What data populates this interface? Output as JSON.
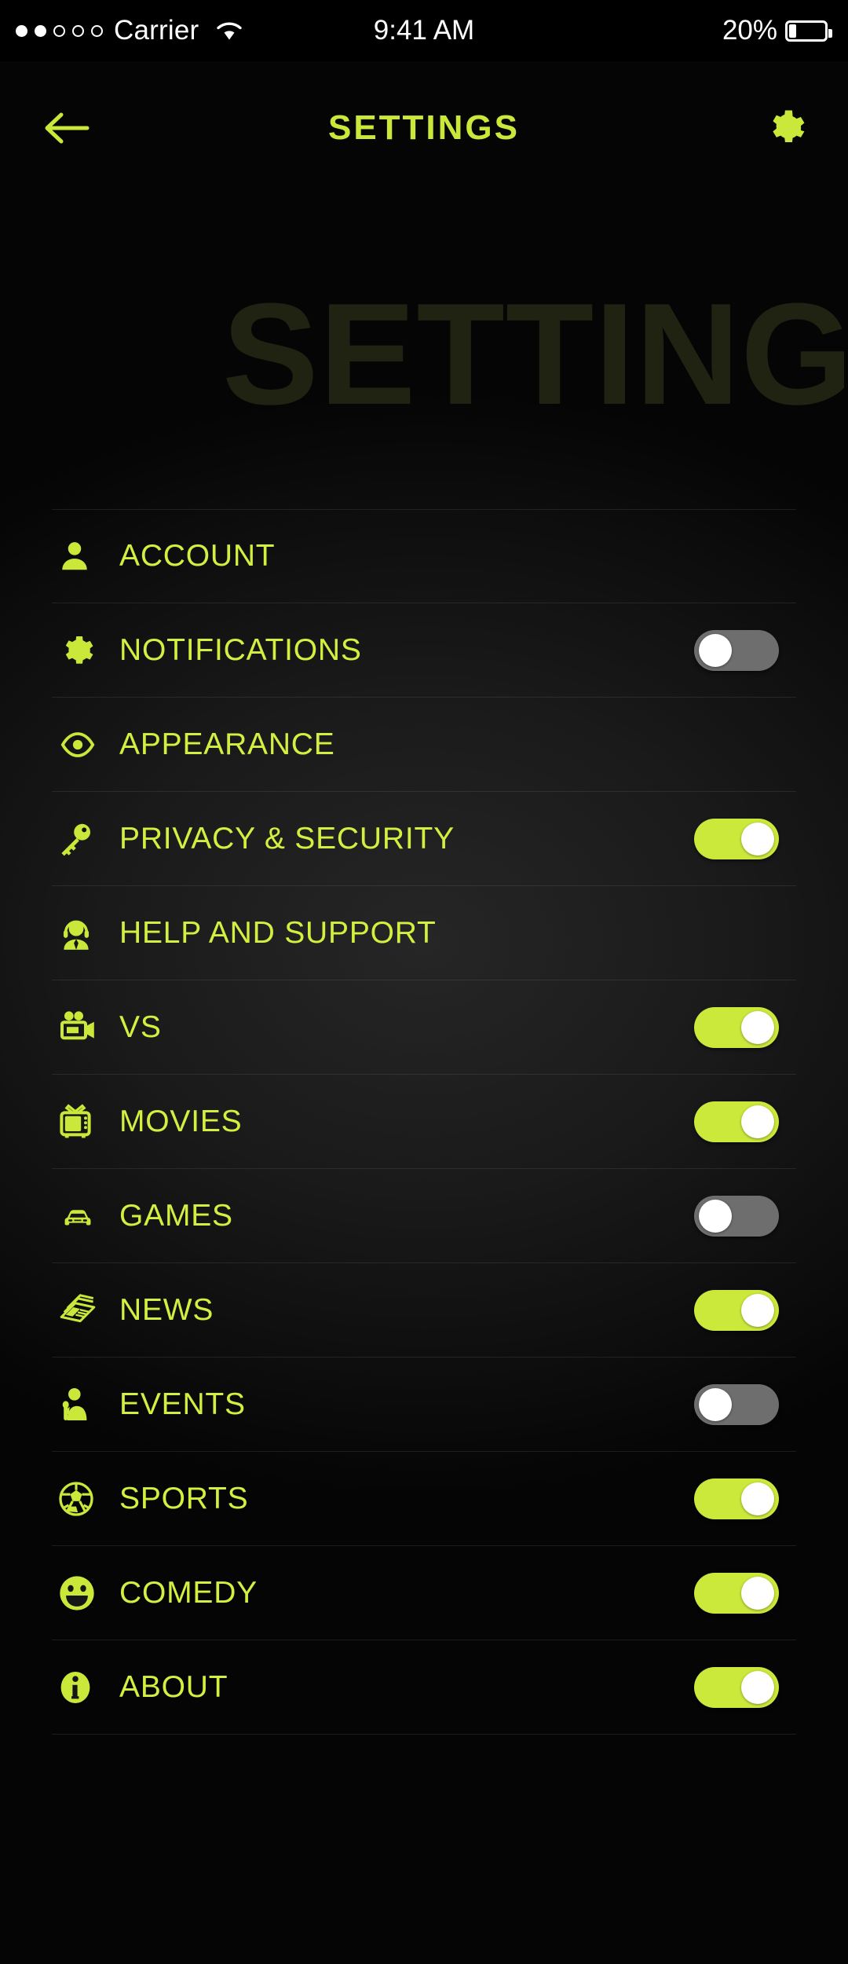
{
  "status_bar": {
    "signal_dots_filled": 2,
    "signal_dots_total": 5,
    "carrier": "Carrier",
    "wifi_icon": "wifi-icon",
    "time": "9:41 AM",
    "battery_percent": "20%",
    "battery_icon": "battery-icon"
  },
  "header": {
    "back_icon": "arrow-left-icon",
    "title": "SETTINGS",
    "gear_icon": "gear-icon"
  },
  "watermark": {
    "text": "SETTING"
  },
  "colors": {
    "accent": "#d4ef3f",
    "toggle_on": "#cbe93b",
    "toggle_off": "#6e6e6e",
    "background": "#111111",
    "watermark": "#2b2f17"
  },
  "list": {
    "items": [
      {
        "label": "ACCOUNT",
        "icon": "person-icon",
        "has_toggle": false,
        "toggle_state": null
      },
      {
        "label": "NOTIFICATIONS",
        "icon": "gear-icon",
        "has_toggle": true,
        "toggle_state": "off"
      },
      {
        "label": "APPEARANCE",
        "icon": "eye-icon",
        "has_toggle": false,
        "toggle_state": null
      },
      {
        "label": "PRIVACY & SECURITY",
        "icon": "key-icon",
        "has_toggle": true,
        "toggle_state": "on"
      },
      {
        "label": "HELP AND SUPPORT",
        "icon": "support-agent-icon",
        "has_toggle": false,
        "toggle_state": null
      },
      {
        "label": "VS",
        "icon": "movie-camera-icon",
        "has_toggle": true,
        "toggle_state": "on"
      },
      {
        "label": "MOVIES",
        "icon": "television-icon",
        "has_toggle": true,
        "toggle_state": "on"
      },
      {
        "label": "GAMES",
        "icon": "car-icon",
        "has_toggle": true,
        "toggle_state": "off"
      },
      {
        "label": "NEWS",
        "icon": "newspaper-icon",
        "has_toggle": true,
        "toggle_state": "on"
      },
      {
        "label": "EVENTS",
        "icon": "singer-icon",
        "has_toggle": true,
        "toggle_state": "off"
      },
      {
        "label": "SPORTS",
        "icon": "soccer-ball-icon",
        "has_toggle": true,
        "toggle_state": "on"
      },
      {
        "label": "COMEDY",
        "icon": "smiley-face-icon",
        "has_toggle": true,
        "toggle_state": "on"
      },
      {
        "label": "ABOUT",
        "icon": "info-circle-icon",
        "has_toggle": true,
        "toggle_state": "on"
      }
    ]
  }
}
